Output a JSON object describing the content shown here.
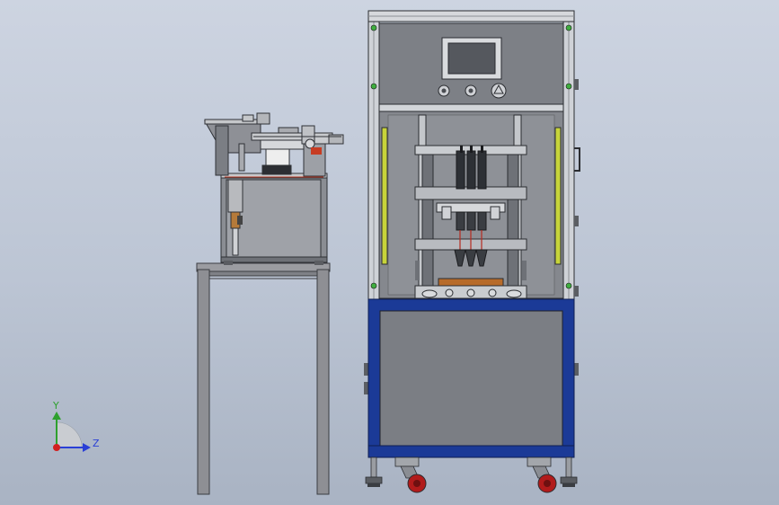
{
  "triad": {
    "y_label": "Y",
    "z_label": "Z",
    "colors": {
      "y": "#2ea02e",
      "z": "#2a3fd6",
      "x": "#d11f1f"
    }
  },
  "colors": {
    "background_top": "#cdd4e1",
    "background_bottom": "#a9b3c3",
    "frame_light": "#d2d6dc",
    "frame_dark": "#6a6f78",
    "panel_gray": "#7a7e85",
    "lower_blue": "#1b3a97",
    "guard_yellow": "#c7d43a",
    "wheel_red": "#b11b1b"
  },
  "feeder": {
    "stand_color": "#8e8f94"
  }
}
